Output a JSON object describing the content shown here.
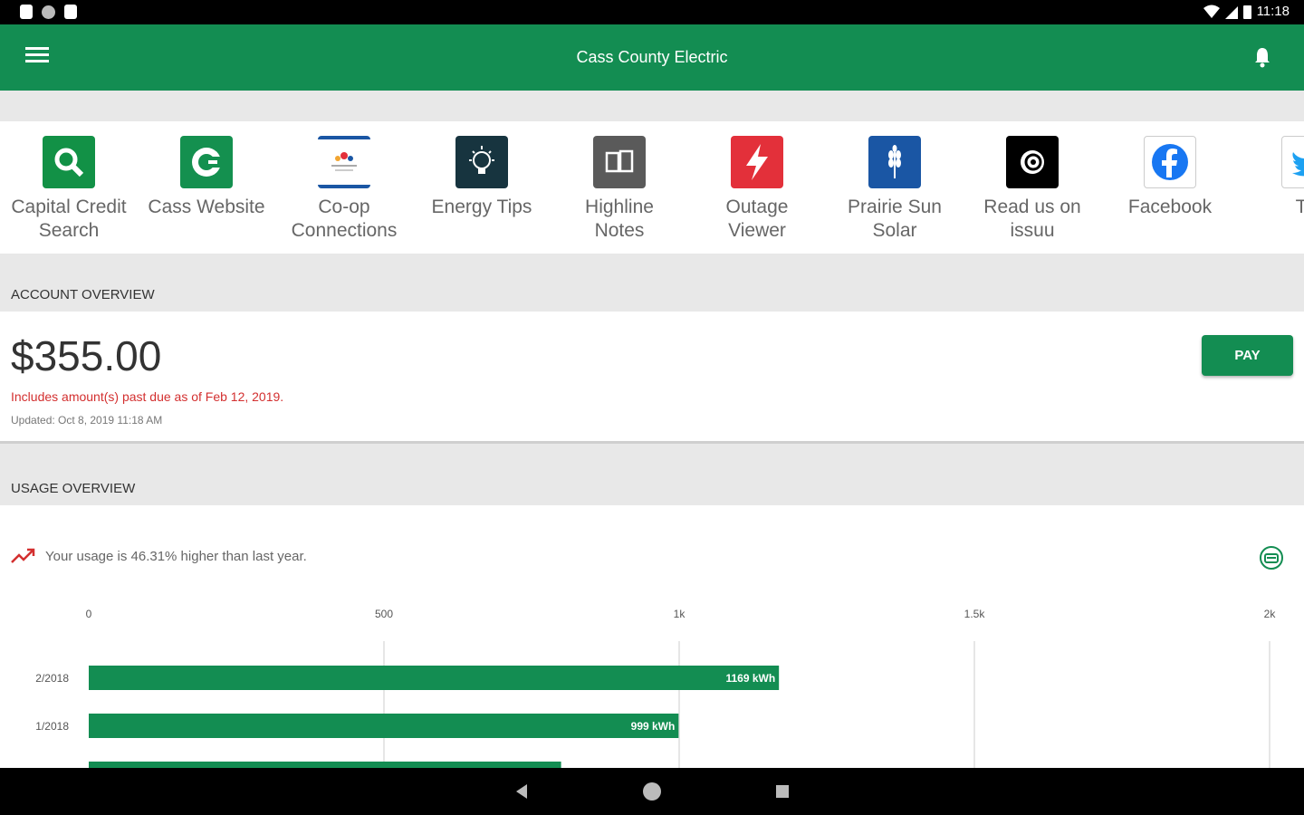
{
  "status_bar": {
    "time": "11:18"
  },
  "app_bar": {
    "title": "Cass County Electric"
  },
  "tiles": [
    {
      "label_1": "Capital Credit",
      "label_2": "Search",
      "color": "#129146"
    },
    {
      "label_1": "Cass Website",
      "label_2": "",
      "color": "#14904f"
    },
    {
      "label_1": "Co-op",
      "label_2": "Connections",
      "color": "#ffffff"
    },
    {
      "label_1": "Energy Tips",
      "label_2": "",
      "color": "#17343f"
    },
    {
      "label_1": "Highline",
      "label_2": "Notes",
      "color": "#5a5a5a"
    },
    {
      "label_1": "Outage",
      "label_2": "Viewer",
      "color": "#e3303a"
    },
    {
      "label_1": "Prairie Sun",
      "label_2": "Solar",
      "color": "#1a56a4"
    },
    {
      "label_1": "Read us on",
      "label_2": "issuu",
      "color": "#000000"
    },
    {
      "label_1": "Facebook",
      "label_2": "",
      "color": "#ffffff"
    },
    {
      "label_1": "Tw",
      "label_2": "",
      "color": "#ffffff"
    }
  ],
  "account": {
    "section_title": "ACCOUNT OVERVIEW",
    "amount": "$355.00",
    "past_due_note": "Includes amount(s) past due as of Feb 12, 2019.",
    "updated": "Updated:  Oct 8, 2019 11:18 AM",
    "pay_label": "PAY"
  },
  "usage": {
    "section_title": "USAGE OVERVIEW",
    "trend_text": "Your usage is 46.31% higher than last year."
  },
  "chart_data": {
    "type": "bar",
    "orientation": "horizontal",
    "x_ticks": [
      "0",
      "500",
      "1k",
      "1.5k",
      "2k"
    ],
    "xlim": [
      0,
      2000
    ],
    "categories": [
      "2/2018",
      "1/2018",
      ""
    ],
    "values": [
      1169,
      999,
      800
    ],
    "value_labels": [
      "1169 kWh",
      "999 kWh",
      ""
    ],
    "color": "#138d52",
    "grid": true
  }
}
